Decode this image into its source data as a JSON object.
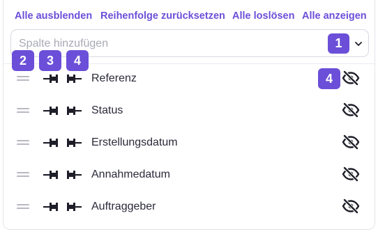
{
  "actions": {
    "hide_all": "Alle ausblenden",
    "reset_order": "Reihenfolge zurücksetzen",
    "unpin_all": "Alle loslösen",
    "show_all": "Alle anzeigen"
  },
  "search": {
    "placeholder": "Spalte hinzufügen",
    "value": ""
  },
  "badges": {
    "b1": "1",
    "b2": "2",
    "b3": "3",
    "b4": "4",
    "b5": "4"
  },
  "columns": [
    {
      "label": "Referenz"
    },
    {
      "label": "Status"
    },
    {
      "label": "Erstellungsdatum"
    },
    {
      "label": "Annahmedatum"
    },
    {
      "label": "Auftraggeber"
    }
  ],
  "icons": {
    "drag": "drag-handle-icon",
    "pin_left": "pin-left-icon",
    "pin_right": "pin-right-icon",
    "visibility": "eye-slash-icon",
    "dropdown": "chevron-down-icon"
  },
  "colors": {
    "accent": "#6b4fd8",
    "text": "#2a2a3a",
    "icon": "#1f1f2a",
    "drag": "#b8b8c2",
    "placeholder": "#a9a9b6"
  }
}
